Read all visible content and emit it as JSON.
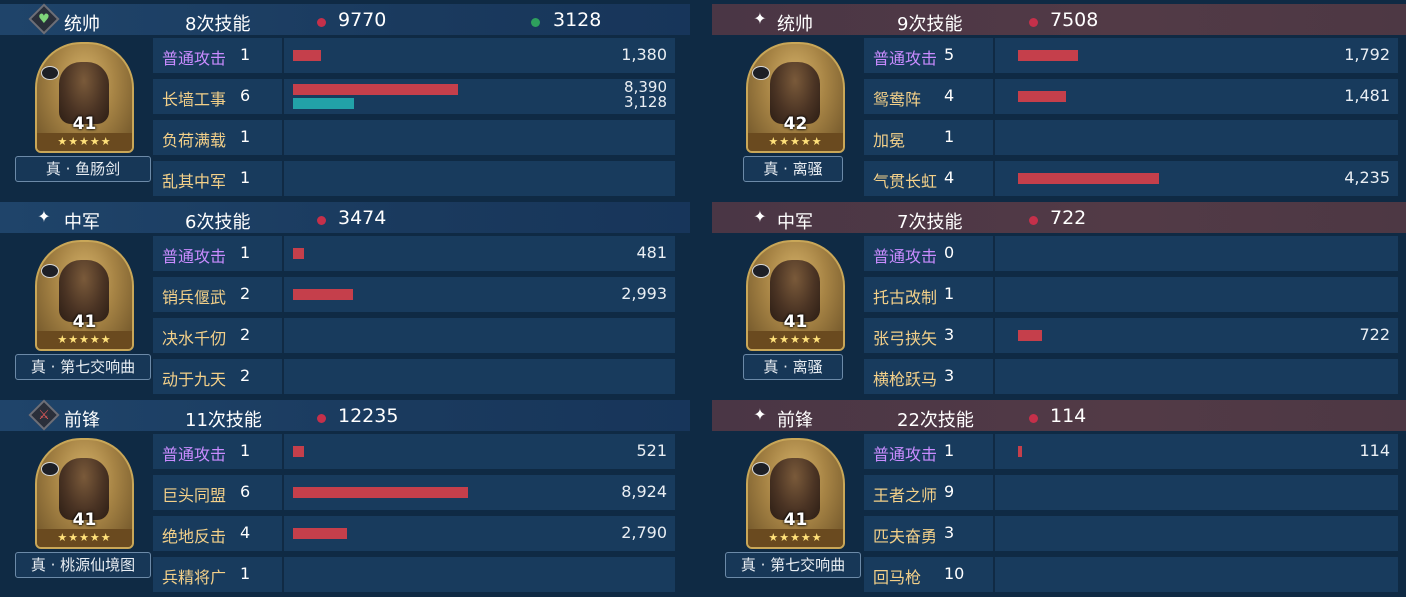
{
  "left": {
    "sections": [
      {
        "role": "统帅",
        "icon": "heart-diamond-icon",
        "icon_glyph": "♥",
        "icon_color": "#7fd47a",
        "skills_cast": "8次技能",
        "damage": "9770",
        "heal": "3128",
        "level": "41",
        "stars": "★★★★★",
        "treasure": "真 · 鱼肠剑",
        "skills": [
          {
            "name": "普通攻击",
            "count": "1",
            "value": "1,380",
            "bar": 0.16,
            "basic": true
          },
          {
            "name": "长墙工事",
            "count": "6",
            "value": "8,390",
            "value2": "3,128",
            "bar": 0.94,
            "bar2": 0.35
          },
          {
            "name": "负荷满载",
            "count": "1"
          },
          {
            "name": "乱其中军",
            "count": "1"
          }
        ]
      },
      {
        "role": "中军",
        "icon": "sparkle-icon",
        "icon_glyph": "✦",
        "skills_cast": "6次技能",
        "damage": "3474",
        "level": "41",
        "stars": "★★★★★",
        "treasure": "真 · 第七交响曲",
        "skills": [
          {
            "name": "普通攻击",
            "count": "1",
            "value": "481",
            "bar": 0.06,
            "basic": true
          },
          {
            "name": "销兵偃武",
            "count": "2",
            "value": "2,993",
            "bar": 0.34
          },
          {
            "name": "决水千仞",
            "count": "2"
          },
          {
            "name": "动于九天",
            "count": "2"
          }
        ]
      },
      {
        "role": "前锋",
        "icon": "sword-diamond-icon",
        "icon_glyph": "⚔",
        "icon_color": "#e35a5a",
        "skills_cast": "11次技能",
        "damage": "12235",
        "level": "41",
        "stars": "★★★★★",
        "treasure": "真 · 桃源仙境图",
        "skills": [
          {
            "name": "普通攻击",
            "count": "1",
            "value": "521",
            "bar": 0.06,
            "basic": true
          },
          {
            "name": "巨头同盟",
            "count": "6",
            "value": "8,924",
            "bar": 1.0
          },
          {
            "name": "绝地反击",
            "count": "4",
            "value": "2,790",
            "bar": 0.31
          },
          {
            "name": "兵精将广",
            "count": "1"
          }
        ]
      }
    ]
  },
  "right": {
    "sections": [
      {
        "role": "统帅",
        "icon": "sparkle-icon",
        "icon_glyph": "✦",
        "skills_cast": "9次技能",
        "damage": "7508",
        "level": "42",
        "stars": "★★★★★",
        "treasure": "真 · 离骚",
        "skills": [
          {
            "name": "普通攻击",
            "count": "5",
            "value": "1,792",
            "bar": 0.2,
            "basic": true
          },
          {
            "name": "鸳鸯阵",
            "count": "4",
            "value": "1,481",
            "bar": 0.16
          },
          {
            "name": "加冕",
            "count": "1"
          },
          {
            "name": "气贯长虹",
            "count": "4",
            "value": "4,235",
            "bar": 0.47
          }
        ]
      },
      {
        "role": "中军",
        "icon": "sparkle-icon",
        "icon_glyph": "✦",
        "skills_cast": "7次技能",
        "damage": "722",
        "level": "41",
        "stars": "★★★★★",
        "treasure": "真 · 离骚",
        "skills": [
          {
            "name": "普通攻击",
            "count": "0",
            "basic": true
          },
          {
            "name": "托古改制",
            "count": "1"
          },
          {
            "name": "张弓挟矢",
            "count": "3",
            "value": "722",
            "bar": 0.08
          },
          {
            "name": "横枪跃马",
            "count": "3"
          }
        ]
      },
      {
        "role": "前锋",
        "icon": "sparkle-icon",
        "icon_glyph": "✦",
        "skills_cast": "22次技能",
        "damage": "114",
        "level": "41",
        "stars": "★★★★★",
        "treasure": "真 · 第七交响曲",
        "skills": [
          {
            "name": "普通攻击",
            "count": "1",
            "value": "114",
            "bar": 0.012,
            "basic": true
          },
          {
            "name": "王者之师",
            "count": "9"
          },
          {
            "name": "匹夫奋勇",
            "count": "3"
          },
          {
            "name": "回马枪",
            "count": "10"
          }
        ]
      }
    ]
  },
  "colors": {
    "damage_dot": "#c5304a",
    "heal_dot": "#2ea05d",
    "bar_damage": "#c53f4b",
    "bar_heal": "#22a2a8",
    "basic_attack_text": "#c98cff",
    "skill_text": "#f3d089",
    "portrait_frame": "#c9a758"
  }
}
